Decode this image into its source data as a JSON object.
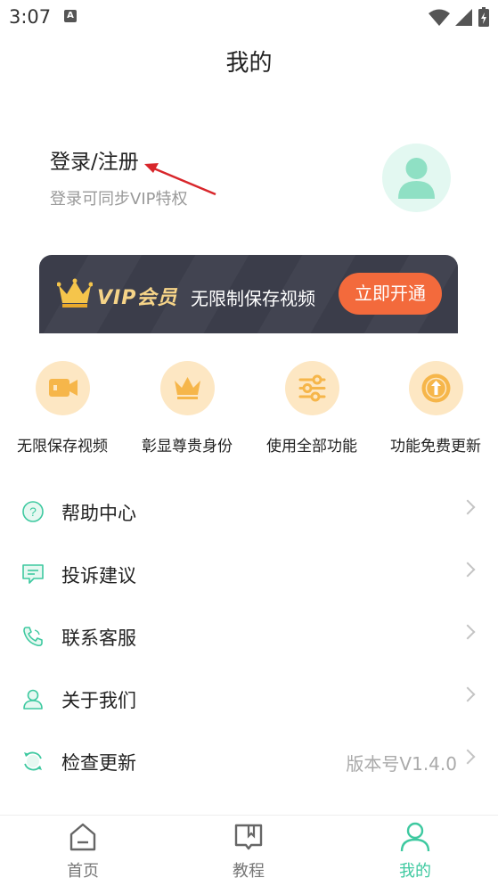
{
  "status": {
    "time": "3:07",
    "notif_letter": "A"
  },
  "page": {
    "title": "我的"
  },
  "profile": {
    "title": "登录/注册",
    "subtitle": "登录可同步VIP特权"
  },
  "vip": {
    "label": "VIP会员",
    "desc": "无限制保存视频",
    "button": "立即开通"
  },
  "features": [
    {
      "label": "无限保存视频",
      "icon": "video-icon"
    },
    {
      "label": "彰显尊贵身份",
      "icon": "crown-icon"
    },
    {
      "label": "使用全部功能",
      "icon": "sliders-icon"
    },
    {
      "label": "功能免费更新",
      "icon": "upgrade-icon"
    }
  ],
  "menu": [
    {
      "label": "帮助中心",
      "icon": "help-icon"
    },
    {
      "label": "投诉建议",
      "icon": "feedback-icon"
    },
    {
      "label": "联系客服",
      "icon": "phone-icon"
    },
    {
      "label": "关于我们",
      "icon": "user-icon"
    },
    {
      "label": "检查更新",
      "icon": "refresh-icon",
      "value": "版本号V1.4.0"
    }
  ],
  "nav": [
    {
      "label": "首页",
      "icon": "home-icon"
    },
    {
      "label": "教程",
      "icon": "book-icon"
    },
    {
      "label": "我的",
      "icon": "profile-icon",
      "active": true
    }
  ],
  "colors": {
    "accent": "#3ec9a0",
    "vip_bg": "#3b3d4a",
    "vip_btn": "#f36a3c",
    "feature_bg": "#fde7c3"
  }
}
